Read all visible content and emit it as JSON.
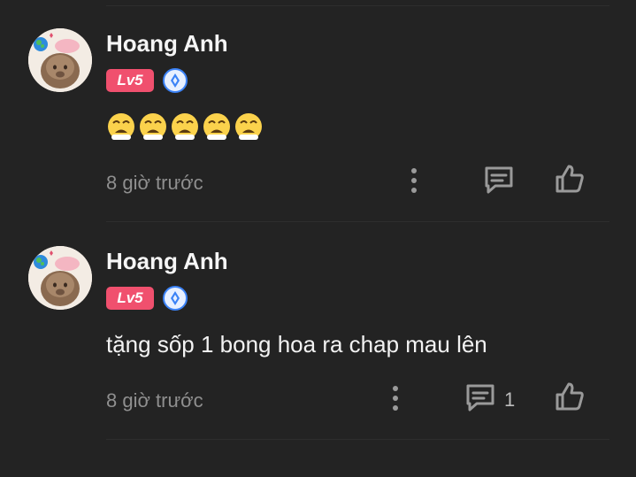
{
  "comments": [
    {
      "username": "Hoang Anh",
      "level": "Lv5",
      "content": "",
      "content_emoji": [
        "weary-face-emoji",
        "weary-face-emoji",
        "weary-face-emoji",
        "weary-face-emoji",
        "weary-face-emoji"
      ],
      "time": "8 giờ trước",
      "reply_count": ""
    },
    {
      "username": "Hoang Anh",
      "level": "Lv5",
      "content": "tặng sốp 1 bong hoa ra chap mau lên",
      "time": "8 giờ trước",
      "reply_count": "1"
    }
  ],
  "colors": {
    "background": "#232323",
    "level_badge": "#f0506e",
    "rank_icon": "#3b82f6",
    "muted_text": "#8f8f8f",
    "icon": "#9a9a9a"
  },
  "icons": {
    "more": "vertical-ellipsis-icon",
    "reply": "chat-bubble-icon",
    "like": "thumbs-up-icon",
    "rank": "diamond-rank-icon"
  }
}
